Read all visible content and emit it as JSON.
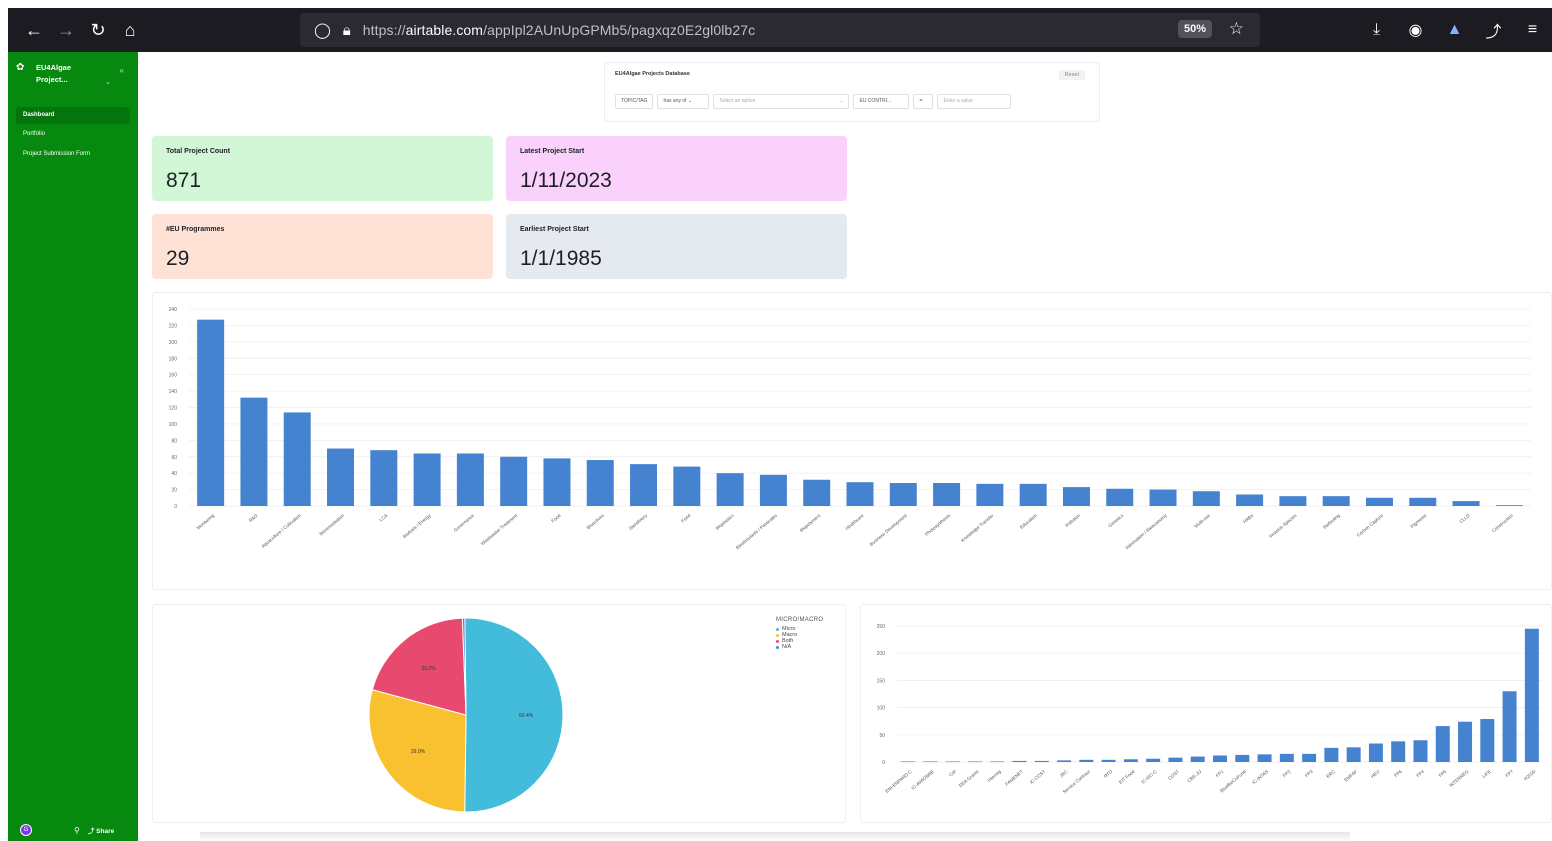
{
  "browser": {
    "url_prefix": "https://",
    "url_domain": "airtable.com",
    "url_path": "/appIpl2AUnUpGPMb5/pagxqz0E2gl0lb27c",
    "zoom": "50%",
    "icons": [
      "back-arrow-icon",
      "forward-arrow-icon",
      "reload-icon",
      "home-icon",
      "shield-icon",
      "lock-icon",
      "star-icon",
      "download-icon",
      "account-icon",
      "extension-icon",
      "share-icon",
      "menu-icon"
    ]
  },
  "sidebar": {
    "base_title_line1": "EU4Algae",
    "base_title_line2": "Project...",
    "items": [
      {
        "label": "Dashboard",
        "active": true
      },
      {
        "label": "Portfolio",
        "active": false
      },
      {
        "label": "Project Submission Form",
        "active": false
      }
    ],
    "avatar_initial": "G",
    "share_label": "Share"
  },
  "filter": {
    "title": "EU4Algae Projects Database",
    "reset_label": "Reset",
    "field1": "TOPIC/TAG",
    "op1": "has any of",
    "value1_placeholder": "Select an option",
    "field2": "EU CONTRI...",
    "op2": "=",
    "value2_placeholder": "Enter a value"
  },
  "cards": [
    {
      "label": "Total Project Count",
      "value": "871",
      "color": "#d1f7d6"
    },
    {
      "label": "Latest Project Start",
      "value": "1/11/2023",
      "color": "#fad1fa"
    },
    {
      "label": "#EU Programmes",
      "value": "29",
      "color": "#fee2d5"
    },
    {
      "label": "Earliest Project Start",
      "value": "1/1/1985",
      "color": "#e5e9f0"
    }
  ],
  "chart_data": [
    {
      "type": "bar",
      "bar_color": "#4583d1",
      "ylim": [
        0,
        240
      ],
      "yticks": [
        0,
        20,
        40,
        60,
        80,
        100,
        120,
        140,
        160,
        180,
        200,
        220,
        240
      ],
      "grid": true,
      "categories": [
        "Monitoring",
        "R&D",
        "Aquaculture / Cultivation",
        "Bioremediation",
        "LCA",
        "Biofuels / Energy",
        "Governance",
        "Wastewater Treatment",
        "Food",
        "Bioactives",
        "Biorefinery",
        "Feed",
        "Bioplastics",
        "Biostimulants / Pesticides",
        "Biopolymers",
        "Healthcare",
        "Business Development",
        "Photosynthesis",
        "Knowledge Transfer",
        "Education",
        "Pollution",
        "Genetics",
        "Valorisation / Bioeconomy",
        "Multi-use",
        "HABs",
        "Invasive Species",
        "Biofouling",
        "Carbon Capture",
        "Pigments",
        "CLLD",
        "Construction"
      ],
      "values": [
        227,
        132,
        114,
        70,
        68,
        64,
        64,
        60,
        58,
        56,
        51,
        48,
        40,
        38,
        32,
        29,
        28,
        28,
        27,
        27,
        23,
        21,
        20,
        18,
        14,
        12,
        12,
        10,
        10,
        6,
        1
      ]
    },
    {
      "type": "pie",
      "legend_title": "MICRO/MACRO",
      "legend_position": "top-right",
      "slices": [
        {
          "label": "Micro",
          "value": 50.4,
          "text": "50.4%",
          "color": "#43bcdb"
        },
        {
          "label": "Macro",
          "value": 29.0,
          "text": "29.0%",
          "color": "#f9c130"
        },
        {
          "label": "Both",
          "value": 20.2,
          "text": "20.2%",
          "color": "#e8496e"
        },
        {
          "label": "N/A",
          "value": 0.4,
          "text": "",
          "color": "#4583d1"
        }
      ]
    },
    {
      "type": "bar",
      "bar_color": "#4583d1",
      "ylim": [
        0,
        250
      ],
      "yticks": [
        0,
        50,
        100,
        150,
        200,
        250
      ],
      "grid": true,
      "categories": [
        "ENI-ENPARD-C",
        "IC-AWIONNE",
        "CIP",
        "EEA Grants",
        "Interreg",
        "FAMENET",
        "IC-COST",
        "JRC",
        "Service Contract",
        "RTD",
        "EIT Food",
        "IC-ISC-C",
        "COST",
        "CBE-JU",
        "FP1",
        "BlueBioCoFund",
        "IC-INTAS",
        "FP2",
        "FP3",
        "ERC",
        "EMFAF",
        "HEU",
        "FP6",
        "FP4",
        "FP5",
        "INTERREG",
        "LIFE",
        "FP7",
        "H2020"
      ],
      "values": [
        1,
        1,
        1,
        1,
        1,
        2,
        2,
        3,
        4,
        4,
        5,
        6,
        8,
        10,
        12,
        13,
        14,
        15,
        15,
        26,
        27,
        34,
        38,
        40,
        66,
        74,
        79,
        130,
        245
      ]
    }
  ]
}
